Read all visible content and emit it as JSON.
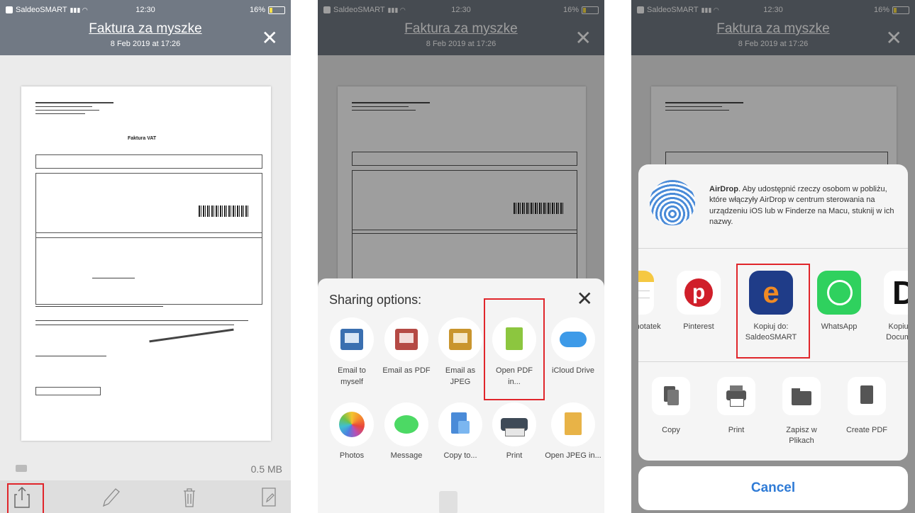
{
  "status_bar": {
    "carrier": "SaldeoSMART",
    "time": "12:30",
    "battery": "16%"
  },
  "header": {
    "title": "Faktura za myszke",
    "subtitle": "8 Feb 2019 at 17:26"
  },
  "document": {
    "heading": "Faktura VAT"
  },
  "panel1": {
    "file_size": "0.5 MB"
  },
  "sharing": {
    "title": "Sharing options:",
    "options": [
      {
        "label": "Email to myself",
        "icon": "envelope-blue-icon"
      },
      {
        "label": "Email as PDF",
        "icon": "envelope-pdf-icon"
      },
      {
        "label": "Email as JPEG",
        "icon": "envelope-jpeg-icon"
      },
      {
        "label": "Open PDF in...",
        "icon": "pdf-file-icon"
      },
      {
        "label": "iCloud Drive",
        "icon": "icloud-icon"
      },
      {
        "label": "Photos",
        "icon": "photos-icon"
      },
      {
        "label": "Message",
        "icon": "message-icon"
      },
      {
        "label": "Copy to...",
        "icon": "copy-to-icon"
      },
      {
        "label": "Print",
        "icon": "printer-icon"
      },
      {
        "label": "Open JPEG in...",
        "icon": "jpeg-file-icon"
      }
    ]
  },
  "share_sheet": {
    "airdrop_title": "AirDrop",
    "airdrop_text": ". Aby udostępnić rzeczy osobom w pobliżu, które włączyły AirDrop w centrum sterowania na urządzeniu iOS lub w Finderze na Macu, stuknij w ich nazwy.",
    "apps": [
      {
        "label": "dodaj do notatek",
        "icon": "notes-icon"
      },
      {
        "label": "Pinterest",
        "icon": "pinterest-icon"
      },
      {
        "label": "Kopiuj do: SaldeoSMART",
        "icon": "saldeosmart-icon"
      },
      {
        "label": "WhatsApp",
        "icon": "whatsapp-icon"
      },
      {
        "label": "Kopiuj do: Documents",
        "icon": "documents-icon"
      }
    ],
    "actions": [
      {
        "label": "Copy",
        "icon": "copy-icon"
      },
      {
        "label": "Print",
        "icon": "print-icon"
      },
      {
        "label": "Zapisz w Plikach",
        "icon": "folder-icon"
      },
      {
        "label": "Create PDF",
        "icon": "create-pdf-icon"
      }
    ],
    "cancel": "Cancel"
  },
  "colors": {
    "navbar": "#717984",
    "highlight": "#e0262b",
    "cancel": "#2f7bd6"
  }
}
